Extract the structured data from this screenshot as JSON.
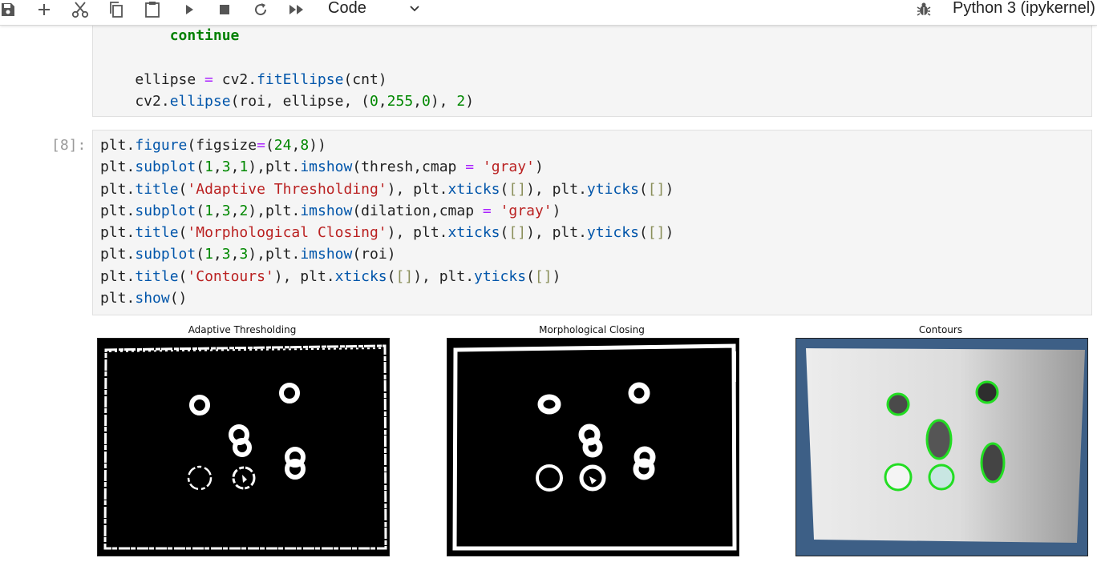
{
  "toolbar": {
    "icons": [
      "save-icon",
      "add-cell-icon",
      "cut-icon",
      "copy-icon",
      "paste-icon",
      "run-icon",
      "stop-icon",
      "restart-icon",
      "run-all-icon"
    ],
    "cell_type": "Code",
    "kernel_name": "Python 3 (ipykernel)"
  },
  "cell7": {
    "lines": [
      "        continue",
      "",
      "    ellipse = cv2.fitEllipse(cnt)",
      "    cv2.ellipse(roi, ellipse, (0,255,0), 2)"
    ]
  },
  "cell8": {
    "prompt": "[8]:",
    "lines": [
      "plt.figure(figsize=(24,8))",
      "plt.subplot(1,3,1),plt.imshow(thresh,cmap = 'gray')",
      "plt.title('Adaptive Thresholding'), plt.xticks([]), plt.yticks([])",
      "plt.subplot(1,3,2),plt.imshow(dilation,cmap = 'gray')",
      "plt.title('Morphological Closing'), plt.xticks([]), plt.yticks([])",
      "plt.subplot(1,3,3),plt.imshow(roi)",
      "plt.title('Contours'), plt.xticks([]), plt.yticks([])",
      "plt.show()"
    ]
  },
  "outputs": {
    "panels": [
      {
        "title": "Adaptive Thresholding"
      },
      {
        "title": "Morphological Closing"
      },
      {
        "title": "Contours"
      }
    ],
    "colors": {
      "contour": "#22dd22",
      "mat_blue": "#3d5f86",
      "paper": "#e8e8e8"
    }
  }
}
